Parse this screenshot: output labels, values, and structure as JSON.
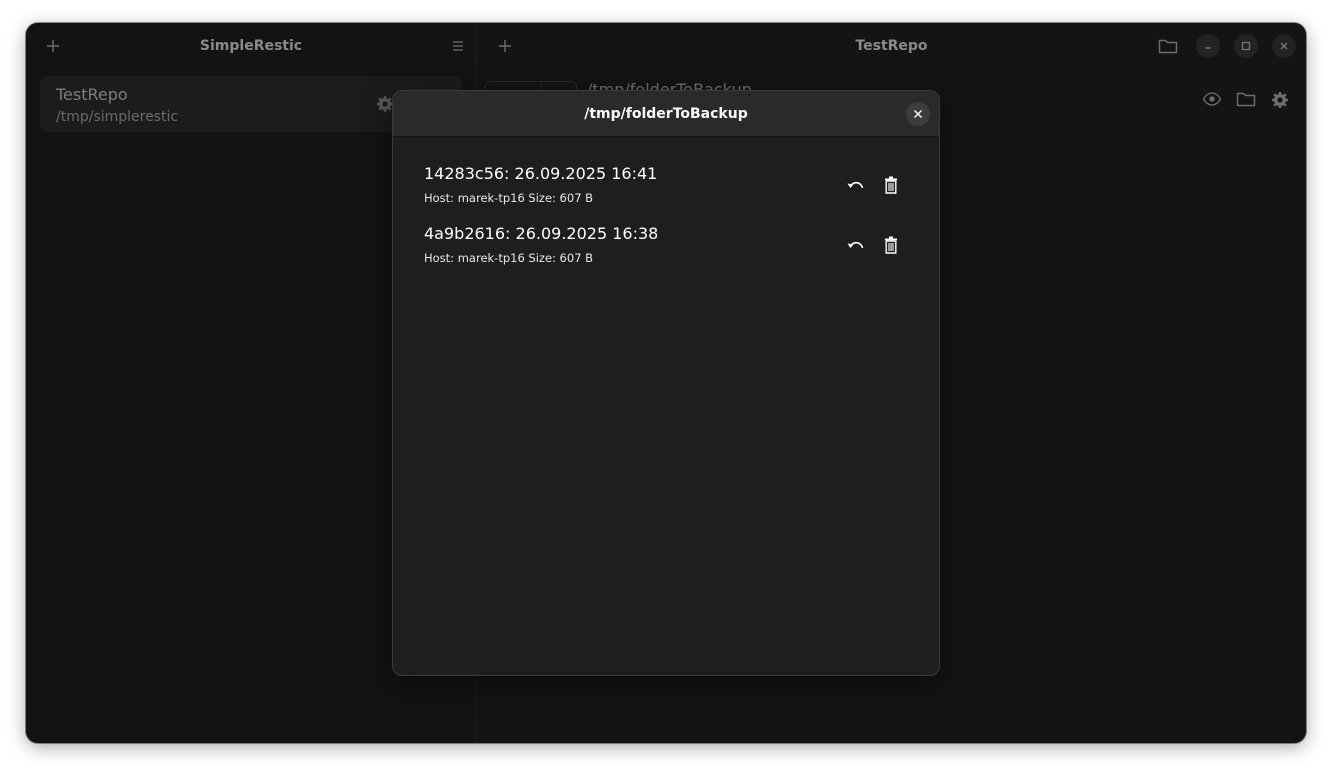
{
  "sidebar": {
    "title": "SimpleRestic",
    "add_icon": "plus-icon",
    "menu_icon": "hamburger-menu-icon",
    "repos": [
      {
        "name": "TestRepo",
        "path": "/tmp/simplerestic",
        "settings_icon": "gear-icon"
      }
    ]
  },
  "content": {
    "title": "TestRepo",
    "add_icon": "plus-icon",
    "folder_icon": "folder-icon",
    "window_controls": [
      "minimize-icon",
      "maximize-icon",
      "close-icon"
    ],
    "folder_path": "/tmp/folderToBackup",
    "row_icons": [
      "eye-icon",
      "folder-icon",
      "gear-icon"
    ]
  },
  "dialog": {
    "title": "/tmp/folderToBackup",
    "close_icon": "close-icon",
    "snapshots": [
      {
        "title": "14283c56: 26.09.2025 16:41",
        "meta": "Host: marek-tp16 Size: 607 B"
      },
      {
        "title": "4a9b2616: 26.09.2025 16:38",
        "meta": "Host: marek-tp16 Size: 607 B"
      }
    ]
  },
  "colors": {
    "window_bg": "#151515",
    "dialog_bg": "#1e1e1e",
    "dialog_header_bg": "#2a2a2a",
    "text_primary": "#ffffff",
    "text_dim": "#7d7d7d"
  }
}
